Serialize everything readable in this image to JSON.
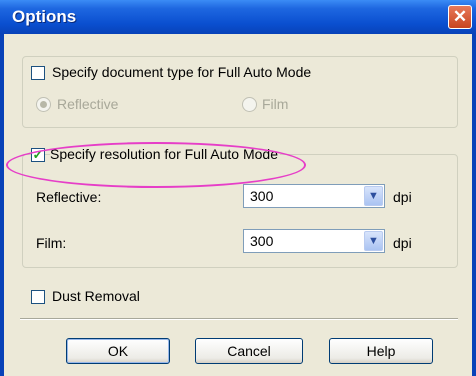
{
  "dialog": {
    "title": "Options",
    "close_glyph": "✕"
  },
  "doc_type": {
    "label": "Specify document type for Full Auto Mode",
    "checked": false,
    "options": [
      "Reflective",
      "Film"
    ],
    "selected": "Reflective",
    "enabled": false
  },
  "resolution": {
    "label": "Specify resolution for Full Auto Mode",
    "checked": true,
    "check_glyph": "✓",
    "reflective_label": "Reflective:",
    "reflective_value": "300",
    "film_label": "Film:",
    "film_value": "300",
    "unit": "dpi",
    "dropdown_glyph": "▼"
  },
  "dust": {
    "label": "Dust Removal",
    "checked": false
  },
  "buttons": {
    "ok": "OK",
    "cancel": "Cancel",
    "help": "Help"
  },
  "colors": {
    "highlight": "#e63ec8",
    "titlebar": "#0a4fd0"
  }
}
